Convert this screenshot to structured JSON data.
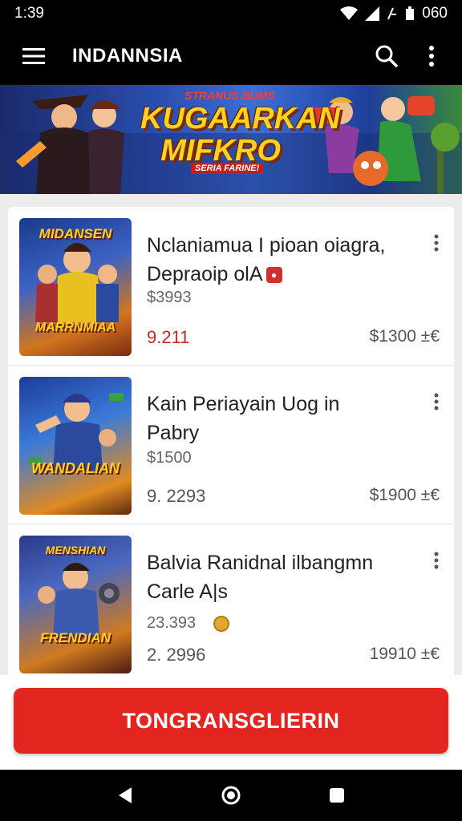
{
  "status_bar": {
    "time": "1:39",
    "battery_text": "060"
  },
  "app_bar": {
    "title": "INDANNSIA",
    "icons": [
      "menu-icon",
      "search-icon",
      "more-vert-icon"
    ]
  },
  "banner": {
    "kicker": "STRANUS BUMS",
    "title_line1": "KUGAARKAN",
    "title_line2": "MIFKRO",
    "tag": "SERIA FARINE!"
  },
  "items": [
    {
      "thumb_top": "MIDANSEN",
      "thumb_bottom": "MARRNMIAA",
      "title_line1": "Nclaniamua I pioan oiagra,",
      "title_line2": "Depraoip olA",
      "price": "$3993",
      "rating": "9.211",
      "total": "$1300 ±€"
    },
    {
      "thumb_top": "",
      "thumb_bottom": "WANDALIAN",
      "title_line1": "Kain Periayain Uog in",
      "title_line2": "Pabry",
      "price": "$1500",
      "rating": "9. 2293",
      "total": "$1900 ±€"
    },
    {
      "thumb_top": "MENSHIAN",
      "thumb_bottom": "FRENDIAN",
      "title_line1": "Balvia Ranidnal ilbangmn",
      "title_line2": "Carle A|s",
      "price": "23.393",
      "rating": "2. 2996",
      "total": "19910 ±€"
    }
  ],
  "cta": {
    "label": "TONGRANSGLIERIN"
  },
  "colors": {
    "accent": "#e3251f",
    "banner_title": "#ffd21f"
  }
}
